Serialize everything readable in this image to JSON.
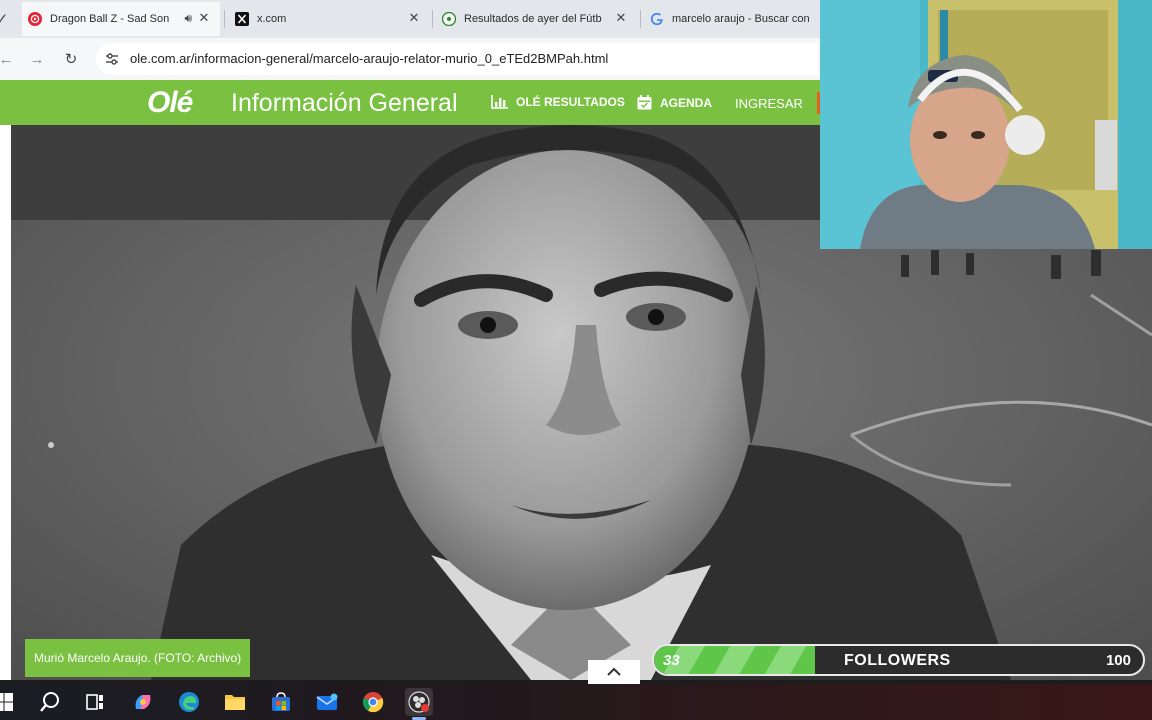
{
  "browser": {
    "tabs": [
      {
        "title": "Dragon Ball Z - Sad Son",
        "icon": "youtube-music-icon",
        "audio": true
      },
      {
        "title": "x.com",
        "icon": "x-logo-icon"
      },
      {
        "title": "Resultados de ayer del Fútb",
        "icon": "soccer-ball-icon"
      },
      {
        "title": "marcelo araujo - Buscar con",
        "icon": "google-icon"
      }
    ],
    "close_glyph": "✕",
    "url": "ole.com.ar/informacion-general/marcelo-araujo-relator-murio_0_eTEd2BMPah.html"
  },
  "site": {
    "logo": "Olé",
    "section": "Información General",
    "nav": [
      {
        "label": "OLÉ RESULTADOS",
        "icon": "bar-chart-icon"
      },
      {
        "label": "AGENDA",
        "icon": "calendar-icon"
      },
      {
        "label": "INGRESAR"
      }
    ]
  },
  "article": {
    "caption": "Murió Marcelo Araujo. (FOTO: Archivo)"
  },
  "stream_overlay": {
    "followers_count": "33",
    "followers_label": "FOLLOWERS",
    "followers_goal": "100",
    "progress": 0.33
  },
  "taskbar": {
    "apps": [
      "windows-start-icon",
      "search-icon",
      "task-view-icon",
      "copilot-icon",
      "edge-icon",
      "file-explorer-icon",
      "microsoft-store-icon",
      "mail-icon",
      "chrome-icon",
      "obs-icon"
    ]
  },
  "colors": {
    "ole_green": "#7ac142",
    "progress_green": "#5fc64a"
  }
}
